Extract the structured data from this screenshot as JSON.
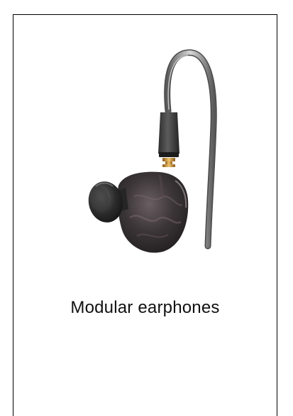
{
  "product": {
    "caption": "Modular earphones",
    "image_icon": "earphone-icon",
    "colors": {
      "border": "#000000",
      "shell": "#3a3536",
      "eartip": "#2b2b2b",
      "cable": "#8a8a8a",
      "connector_pin": "#c8953c"
    }
  }
}
